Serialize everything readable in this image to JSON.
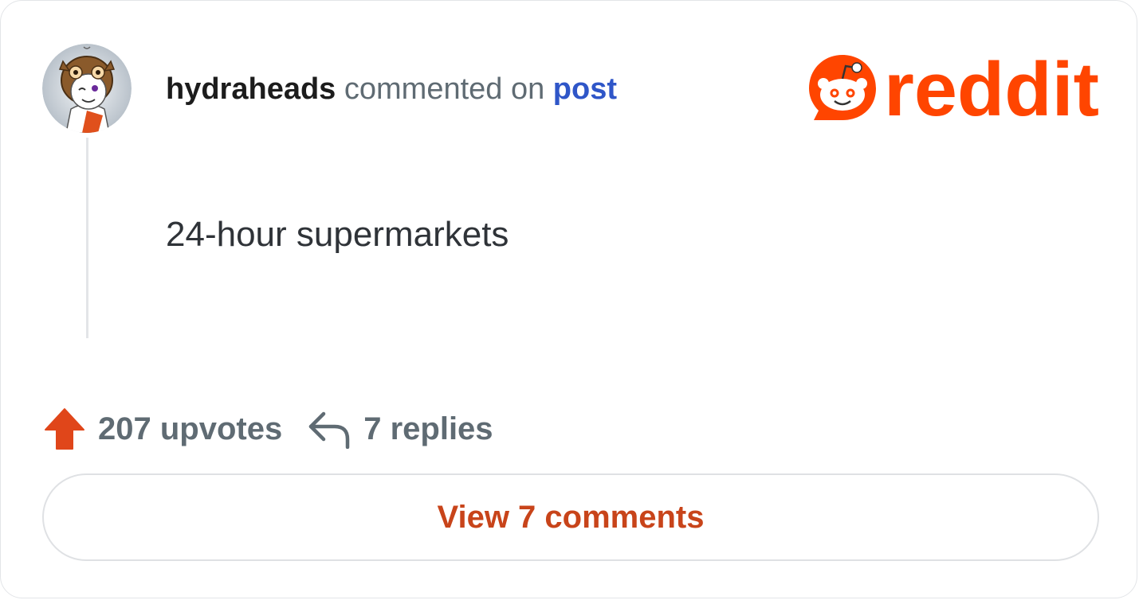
{
  "header": {
    "username": "hydraheads",
    "verb": " commented on ",
    "post_link": "post"
  },
  "logo": {
    "wordmark": "reddit",
    "brand_color": "#ff4500"
  },
  "comment": {
    "text": "24-hour supermarkets"
  },
  "stats": {
    "upvotes": "207 upvotes",
    "replies": "7 replies",
    "upvote_icon": "upvote-arrow-icon",
    "reply_icon": "reply-arrow-icon"
  },
  "actions": {
    "view_comments": "View 7 comments"
  },
  "colors": {
    "accent_link": "#2f56c8",
    "button_text": "#c8441a",
    "upvote": "#e0461a"
  }
}
